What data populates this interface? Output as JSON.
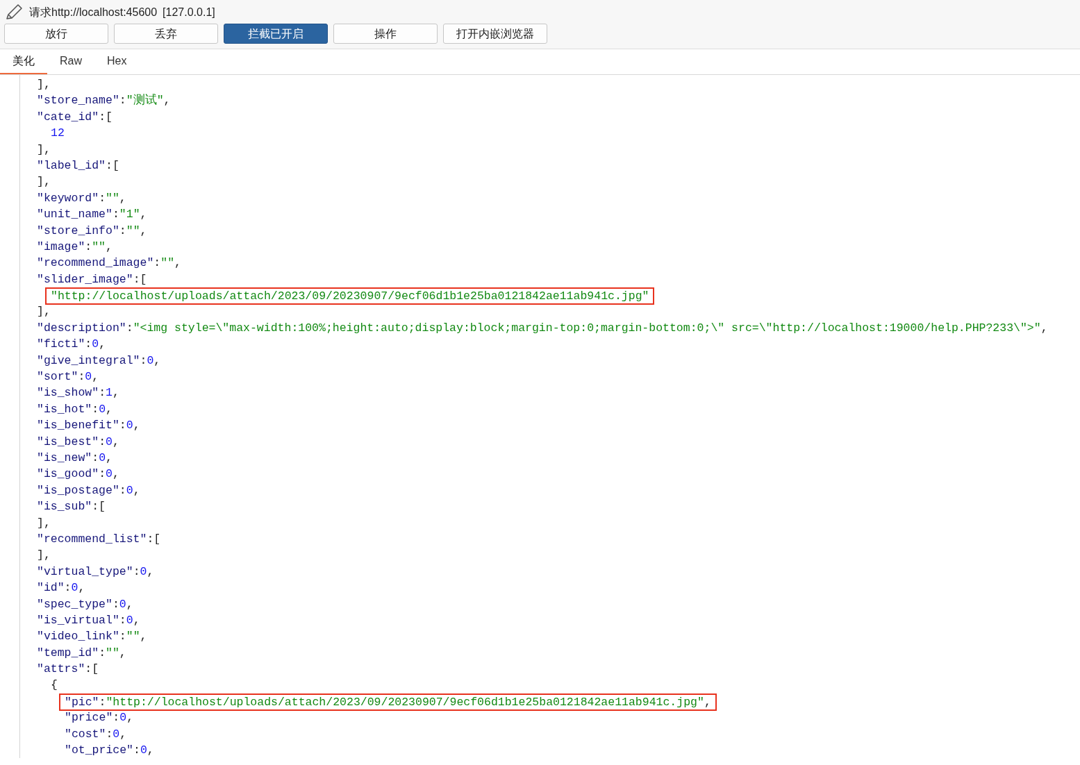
{
  "header": {
    "title": "请求http://localhost:45600",
    "address": "[127.0.0.1]"
  },
  "buttons": [
    {
      "label": "放行",
      "on": false
    },
    {
      "label": "丢弃",
      "on": false
    },
    {
      "label": "拦截已开启",
      "on": true
    },
    {
      "label": "操作",
      "on": false
    },
    {
      "label": "打开内嵌浏览器",
      "on": false
    }
  ],
  "tabs": [
    {
      "label": "美化",
      "selected": true
    },
    {
      "label": "Raw",
      "selected": false
    },
    {
      "label": "Hex",
      "selected": false
    }
  ],
  "lines": [
    {
      "tokens": [
        {
          "kind": "punct",
          "text": "],"
        }
      ],
      "highlighted": false
    },
    {
      "tokens": [
        {
          "kind": "key",
          "text": "\"store_name\""
        },
        {
          "kind": "punct",
          "text": ":"
        },
        {
          "kind": "string",
          "text": "\"测试\""
        },
        {
          "kind": "punct",
          "text": ","
        }
      ],
      "highlighted": false
    },
    {
      "tokens": [
        {
          "kind": "key",
          "text": "\"cate_id\""
        },
        {
          "kind": "punct",
          "text": ":["
        }
      ],
      "highlighted": false,
      "children": [
        {
          "tokens": [
            {
              "kind": "number",
              "text": "12"
            }
          ],
          "highlighted": false
        }
      ]
    },
    {
      "tokens": [
        {
          "kind": "punct",
          "text": "],"
        }
      ],
      "highlighted": false
    },
    {
      "tokens": [
        {
          "kind": "key",
          "text": "\"label_id\""
        },
        {
          "kind": "punct",
          "text": ":["
        }
      ],
      "highlighted": false
    },
    {
      "tokens": [
        {
          "kind": "punct",
          "text": "],"
        }
      ],
      "highlighted": false
    },
    {
      "tokens": [
        {
          "kind": "key",
          "text": "\"keyword\""
        },
        {
          "kind": "punct",
          "text": ":"
        },
        {
          "kind": "string",
          "text": "\"\""
        },
        {
          "kind": "punct",
          "text": ","
        }
      ],
      "highlighted": false
    },
    {
      "tokens": [
        {
          "kind": "key",
          "text": "\"unit_name\""
        },
        {
          "kind": "punct",
          "text": ":"
        },
        {
          "kind": "string",
          "text": "\"1\""
        },
        {
          "kind": "punct",
          "text": ","
        }
      ],
      "highlighted": false
    },
    {
      "tokens": [
        {
          "kind": "key",
          "text": "\"store_info\""
        },
        {
          "kind": "punct",
          "text": ":"
        },
        {
          "kind": "string",
          "text": "\"\""
        },
        {
          "kind": "punct",
          "text": ","
        }
      ],
      "highlighted": false
    },
    {
      "tokens": [
        {
          "kind": "key",
          "text": "\"image\""
        },
        {
          "kind": "punct",
          "text": ":"
        },
        {
          "kind": "string",
          "text": "\"\""
        },
        {
          "kind": "punct",
          "text": ","
        }
      ],
      "highlighted": false
    },
    {
      "tokens": [
        {
          "kind": "key",
          "text": "\"recommend_image\""
        },
        {
          "kind": "punct",
          "text": ":"
        },
        {
          "kind": "string",
          "text": "\"\""
        },
        {
          "kind": "punct",
          "text": ","
        }
      ],
      "highlighted": false
    },
    {
      "tokens": [
        {
          "kind": "key",
          "text": "\"slider_image\""
        },
        {
          "kind": "punct",
          "text": ":["
        }
      ],
      "highlighted": false,
      "children": [
        {
          "tokens": [
            {
              "kind": "string",
              "text": "\"http://localhost/uploads/attach/2023/09/20230907/9ecf06d1b1e25ba0121842ae11ab941c.jpg\""
            }
          ],
          "highlighted": true
        }
      ]
    },
    {
      "tokens": [
        {
          "kind": "punct",
          "text": "],"
        }
      ],
      "highlighted": false
    },
    {
      "tokens": [
        {
          "kind": "key",
          "text": "\"description\""
        },
        {
          "kind": "punct",
          "text": ":"
        },
        {
          "kind": "string",
          "text": "\"<img style=\\\"max-width:100%;height:auto;display:block;margin-top:0;margin-bottom:0;\\\" src=\\\"http://localhost:19000/help.PHP?233\\\">\""
        },
        {
          "kind": "punct",
          "text": ","
        }
      ],
      "highlighted": false
    },
    {
      "tokens": [
        {
          "kind": "key",
          "text": "\"ficti\""
        },
        {
          "kind": "punct",
          "text": ":"
        },
        {
          "kind": "number",
          "text": "0"
        },
        {
          "kind": "punct",
          "text": ","
        }
      ],
      "highlighted": false
    },
    {
      "tokens": [
        {
          "kind": "key",
          "text": "\"give_integral\""
        },
        {
          "kind": "punct",
          "text": ":"
        },
        {
          "kind": "number",
          "text": "0"
        },
        {
          "kind": "punct",
          "text": ","
        }
      ],
      "highlighted": false
    },
    {
      "tokens": [
        {
          "kind": "key",
          "text": "\"sort\""
        },
        {
          "kind": "punct",
          "text": ":"
        },
        {
          "kind": "number",
          "text": "0"
        },
        {
          "kind": "punct",
          "text": ","
        }
      ],
      "highlighted": false
    },
    {
      "tokens": [
        {
          "kind": "key",
          "text": "\"is_show\""
        },
        {
          "kind": "punct",
          "text": ":"
        },
        {
          "kind": "number",
          "text": "1"
        },
        {
          "kind": "punct",
          "text": ","
        }
      ],
      "highlighted": false
    },
    {
      "tokens": [
        {
          "kind": "key",
          "text": "\"is_hot\""
        },
        {
          "kind": "punct",
          "text": ":"
        },
        {
          "kind": "number",
          "text": "0"
        },
        {
          "kind": "punct",
          "text": ","
        }
      ],
      "highlighted": false
    },
    {
      "tokens": [
        {
          "kind": "key",
          "text": "\"is_benefit\""
        },
        {
          "kind": "punct",
          "text": ":"
        },
        {
          "kind": "number",
          "text": "0"
        },
        {
          "kind": "punct",
          "text": ","
        }
      ],
      "highlighted": false
    },
    {
      "tokens": [
        {
          "kind": "key",
          "text": "\"is_best\""
        },
        {
          "kind": "punct",
          "text": ":"
        },
        {
          "kind": "number",
          "text": "0"
        },
        {
          "kind": "punct",
          "text": ","
        }
      ],
      "highlighted": false
    },
    {
      "tokens": [
        {
          "kind": "key",
          "text": "\"is_new\""
        },
        {
          "kind": "punct",
          "text": ":"
        },
        {
          "kind": "number",
          "text": "0"
        },
        {
          "kind": "punct",
          "text": ","
        }
      ],
      "highlighted": false
    },
    {
      "tokens": [
        {
          "kind": "key",
          "text": "\"is_good\""
        },
        {
          "kind": "punct",
          "text": ":"
        },
        {
          "kind": "number",
          "text": "0"
        },
        {
          "kind": "punct",
          "text": ","
        }
      ],
      "highlighted": false
    },
    {
      "tokens": [
        {
          "kind": "key",
          "text": "\"is_postage\""
        },
        {
          "kind": "punct",
          "text": ":"
        },
        {
          "kind": "number",
          "text": "0"
        },
        {
          "kind": "punct",
          "text": ","
        }
      ],
      "highlighted": false
    },
    {
      "tokens": [
        {
          "kind": "key",
          "text": "\"is_sub\""
        },
        {
          "kind": "punct",
          "text": ":["
        }
      ],
      "highlighted": false
    },
    {
      "tokens": [
        {
          "kind": "punct",
          "text": "],"
        }
      ],
      "highlighted": false
    },
    {
      "tokens": [
        {
          "kind": "key",
          "text": "\"recommend_list\""
        },
        {
          "kind": "punct",
          "text": ":["
        }
      ],
      "highlighted": false
    },
    {
      "tokens": [
        {
          "kind": "punct",
          "text": "],"
        }
      ],
      "highlighted": false
    },
    {
      "tokens": [
        {
          "kind": "key",
          "text": "\"virtual_type\""
        },
        {
          "kind": "punct",
          "text": ":"
        },
        {
          "kind": "number",
          "text": "0"
        },
        {
          "kind": "punct",
          "text": ","
        }
      ],
      "highlighted": false
    },
    {
      "tokens": [
        {
          "kind": "key",
          "text": "\"id\""
        },
        {
          "kind": "punct",
          "text": ":"
        },
        {
          "kind": "number",
          "text": "0"
        },
        {
          "kind": "punct",
          "text": ","
        }
      ],
      "highlighted": false
    },
    {
      "tokens": [
        {
          "kind": "key",
          "text": "\"spec_type\""
        },
        {
          "kind": "punct",
          "text": ":"
        },
        {
          "kind": "number",
          "text": "0"
        },
        {
          "kind": "punct",
          "text": ","
        }
      ],
      "highlighted": false
    },
    {
      "tokens": [
        {
          "kind": "key",
          "text": "\"is_virtual\""
        },
        {
          "kind": "punct",
          "text": ":"
        },
        {
          "kind": "number",
          "text": "0"
        },
        {
          "kind": "punct",
          "text": ","
        }
      ],
      "highlighted": false
    },
    {
      "tokens": [
        {
          "kind": "key",
          "text": "\"video_link\""
        },
        {
          "kind": "punct",
          "text": ":"
        },
        {
          "kind": "string",
          "text": "\"\""
        },
        {
          "kind": "punct",
          "text": ","
        }
      ],
      "highlighted": false
    },
    {
      "tokens": [
        {
          "kind": "key",
          "text": "\"temp_id\""
        },
        {
          "kind": "punct",
          "text": ":"
        },
        {
          "kind": "string",
          "text": "\"\""
        },
        {
          "kind": "punct",
          "text": ","
        }
      ],
      "highlighted": false
    },
    {
      "tokens": [
        {
          "kind": "key",
          "text": "\"attrs\""
        },
        {
          "kind": "punct",
          "text": ":["
        }
      ],
      "highlighted": false,
      "children": [
        {
          "tokens": [
            {
              "kind": "punct",
              "text": "{"
            }
          ],
          "highlighted": false,
          "children": [
            {
              "tokens": [
                {
                  "kind": "key",
                  "text": "\"pic\""
                },
                {
                  "kind": "punct",
                  "text": ":"
                },
                {
                  "kind": "string",
                  "text": "\"http://localhost/uploads/attach/2023/09/20230907/9ecf06d1b1e25ba0121842ae11ab941c.jpg\""
                },
                {
                  "kind": "punct",
                  "text": ","
                }
              ],
              "highlighted": true
            },
            {
              "tokens": [
                {
                  "kind": "key",
                  "text": "\"price\""
                },
                {
                  "kind": "punct",
                  "text": ":"
                },
                {
                  "kind": "number",
                  "text": "0"
                },
                {
                  "kind": "punct",
                  "text": ","
                }
              ],
              "highlighted": false
            },
            {
              "tokens": [
                {
                  "kind": "key",
                  "text": "\"cost\""
                },
                {
                  "kind": "punct",
                  "text": ":"
                },
                {
                  "kind": "number",
                  "text": "0"
                },
                {
                  "kind": "punct",
                  "text": ","
                }
              ],
              "highlighted": false
            },
            {
              "tokens": [
                {
                  "kind": "key",
                  "text": "\"ot_price\""
                },
                {
                  "kind": "punct",
                  "text": ":"
                },
                {
                  "kind": "number",
                  "text": "0"
                },
                {
                  "kind": "punct",
                  "text": ","
                }
              ],
              "highlighted": false
            }
          ]
        }
      ]
    }
  ]
}
